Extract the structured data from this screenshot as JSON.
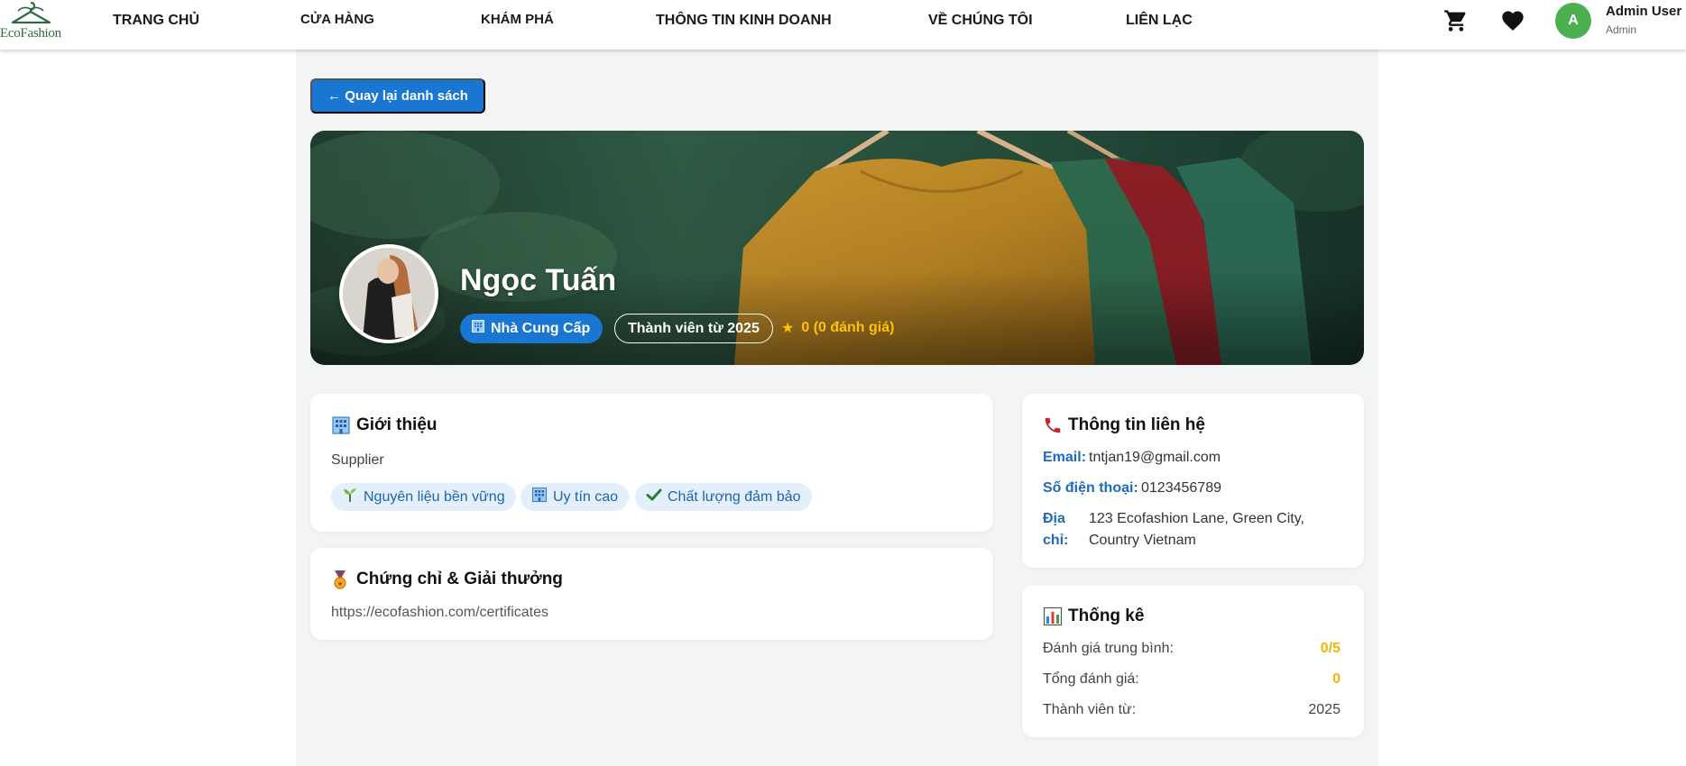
{
  "brand": {
    "name": "EcoFashion"
  },
  "nav": {
    "items": [
      {
        "label": "TRANG CHỦ"
      },
      {
        "label": "CỬA HÀNG"
      },
      {
        "label": "KHÁM PHÁ"
      },
      {
        "label": "THÔNG TIN KINH DOANH"
      },
      {
        "label": "VỀ CHÚNG TÔI"
      },
      {
        "label": "LIÊN LẠC"
      }
    ],
    "cart_icon": "cart-icon",
    "wishlist_icon": "heart-icon"
  },
  "user": {
    "initial": "A",
    "name": "Admin User",
    "role": "Admin"
  },
  "back_button": {
    "label": "← Quay lại danh sách"
  },
  "profile": {
    "name": "Ngọc Tuấn",
    "role_badge": "Nhà Cung Cấp",
    "member_since_badge": "Thành viên từ 2025",
    "rating_text": "0 (0 đánh giá)"
  },
  "intro": {
    "title": "Giới thiệu",
    "text": "Supplier",
    "tags": [
      {
        "label": "Nguyên liệu bền vững",
        "icon": "seedling-icon"
      },
      {
        "label": "Uy tín cao",
        "icon": "building-icon"
      },
      {
        "label": "Chất lượng đảm bảo",
        "icon": "checkmark-icon"
      }
    ]
  },
  "certificates": {
    "title": "Chứng chỉ & Giải thưởng",
    "text": "https://ecofashion.com/certificates"
  },
  "contact": {
    "title": "Thông tin liên hệ",
    "email_label": "Email:",
    "email": "tntjan19@gmail.com",
    "phone_label": "Số điện thoại:",
    "phone": "0123456789",
    "address_label_1": "Địa",
    "address_label_2": "chỉ:",
    "address_line1": "123 Ecofashion Lane, Green City,",
    "address_line2": "Country Vietnam"
  },
  "stats": {
    "title": "Thống kê",
    "rows": [
      {
        "label": "Đánh giá trung bình:",
        "value": "0/5"
      },
      {
        "label": "Tổng đánh giá:",
        "value": "0"
      },
      {
        "label": "Thành viên từ:",
        "value": "2025"
      }
    ]
  },
  "colors": {
    "primary": "#1976d2",
    "accent_green": "#4caf50",
    "rating_gold": "#ffc107",
    "page_bg": "#f3f4f6"
  }
}
